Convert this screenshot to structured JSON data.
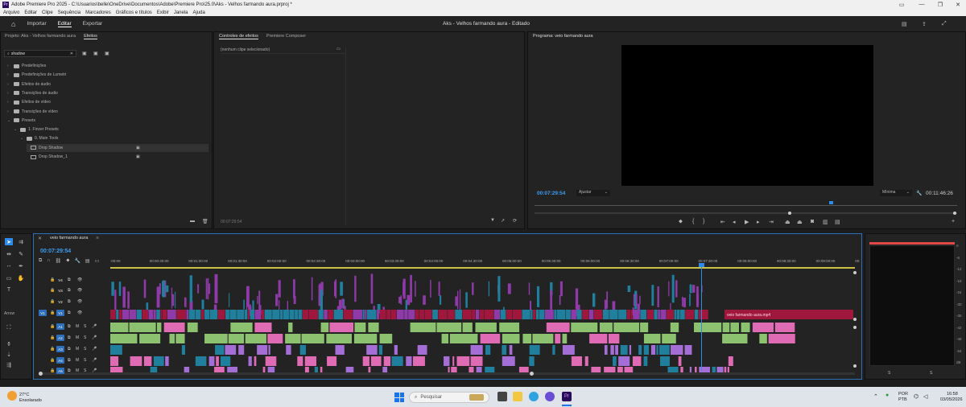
{
  "window": {
    "title": "Adobe Premiere Pro 2025 - C:\\Usuarios\\belle\\OneDrive\\Documentos\\Adobe\\Premiere Pro\\25.0\\Aks - Velhos farmando aura.prproj *",
    "logo_text": "Pr"
  },
  "menu": [
    "Arquivo",
    "Editar",
    "Clipe",
    "Sequência",
    "Marcadores",
    "Gráficos e títulos",
    "Exibir",
    "Janela",
    "Ajuda"
  ],
  "header": {
    "tabs": [
      "Importar",
      "Editar",
      "Exportar"
    ],
    "active_tab": "Editar",
    "project_title": "Aks - Velhos farmando aura - Editado"
  },
  "project_panel": {
    "tab_project": "Projeto: Aks - Velhos farmando aura",
    "tab_effects": "Efeitos",
    "search_value": "shadow",
    "tree": [
      {
        "label": "Predefinições",
        "indent": 0,
        "open": false
      },
      {
        "label": "Predefinições de Lumetri",
        "indent": 0,
        "open": false
      },
      {
        "label": "Efeitos de áudio",
        "indent": 0,
        "open": false
      },
      {
        "label": "Transições de áudio",
        "indent": 0,
        "open": false
      },
      {
        "label": "Efeitos de vídeo",
        "indent": 0,
        "open": false
      },
      {
        "label": "Transições de vídeo",
        "indent": 0,
        "open": false
      },
      {
        "label": "Presets",
        "indent": 0,
        "open": true
      },
      {
        "label": "1. Finzer Presets",
        "indent": 1,
        "open": true
      },
      {
        "label": "0. Main Tools",
        "indent": 2,
        "open": true
      },
      {
        "label": "Drop Shadow",
        "indent": 3,
        "open": null
      },
      {
        "label": "Drop Shadow_1",
        "indent": 3,
        "open": null
      }
    ]
  },
  "effect_controls": {
    "tab": "Controles de efeitos",
    "tab2": "Premiere Composer",
    "empty_text": "(nenhum clipe selecionado)",
    "timecode": "00:07:29:54"
  },
  "program_monitor": {
    "tab": "Programa: veio farmando aura",
    "timecode": "00:07:29:54",
    "fit": "Ajustar",
    "quality": "Mínima",
    "duration": "00:11:46:26"
  },
  "timeline": {
    "sequence_tab": "veio farmando aura",
    "timecode": "00:07:29:54",
    "ruler": [
      ":00:00",
      "00:00:30:00",
      "00:01:00:00",
      "00:01:30:00",
      "00:02:00:00",
      "00:02:30:00",
      "00:03:00:00",
      "00:03:30:00",
      "00:04:00:00",
      "00:04:30:00",
      "00:05:00:00",
      "00:05:30:00",
      "00:06:00:00",
      "00:06:30:00",
      "00:07:00:00",
      "00:07:30:00",
      "00:08:00:00",
      "00:08:30:00",
      "00:09:00:00",
      "00:"
    ],
    "video_tracks": [
      "V4",
      "V3",
      "V2",
      "V1"
    ],
    "audio_tracks": [
      "A1",
      "A2",
      "A3",
      "A4",
      "A5"
    ],
    "clip_label": "veio farmando aura.mp4",
    "tool_label": "Arrow"
  },
  "audio_meter": {
    "scale": [
      "0",
      "-6",
      "-12",
      "-18",
      "-24",
      "-30",
      "-36",
      "-42",
      "-48",
      "-54",
      "dB"
    ],
    "channels": [
      "S",
      "S"
    ]
  },
  "taskbar": {
    "weather_temp": "27°C",
    "weather_text": "Ensolarado",
    "search_placeholder": "Pesquisar",
    "lang1": "POR",
    "lang2": "PTB",
    "time": "16:58",
    "date": "03/05/2026"
  },
  "colors": {
    "video_blue": "#1f7f9c",
    "video_purple": "#8e3aa8",
    "video_red": "#a0173e",
    "audio_green": "#8cc26f",
    "audio_pink": "#e06bb5",
    "audio_violet": "#a56ed6",
    "accent_blue": "#2d8ceb"
  }
}
